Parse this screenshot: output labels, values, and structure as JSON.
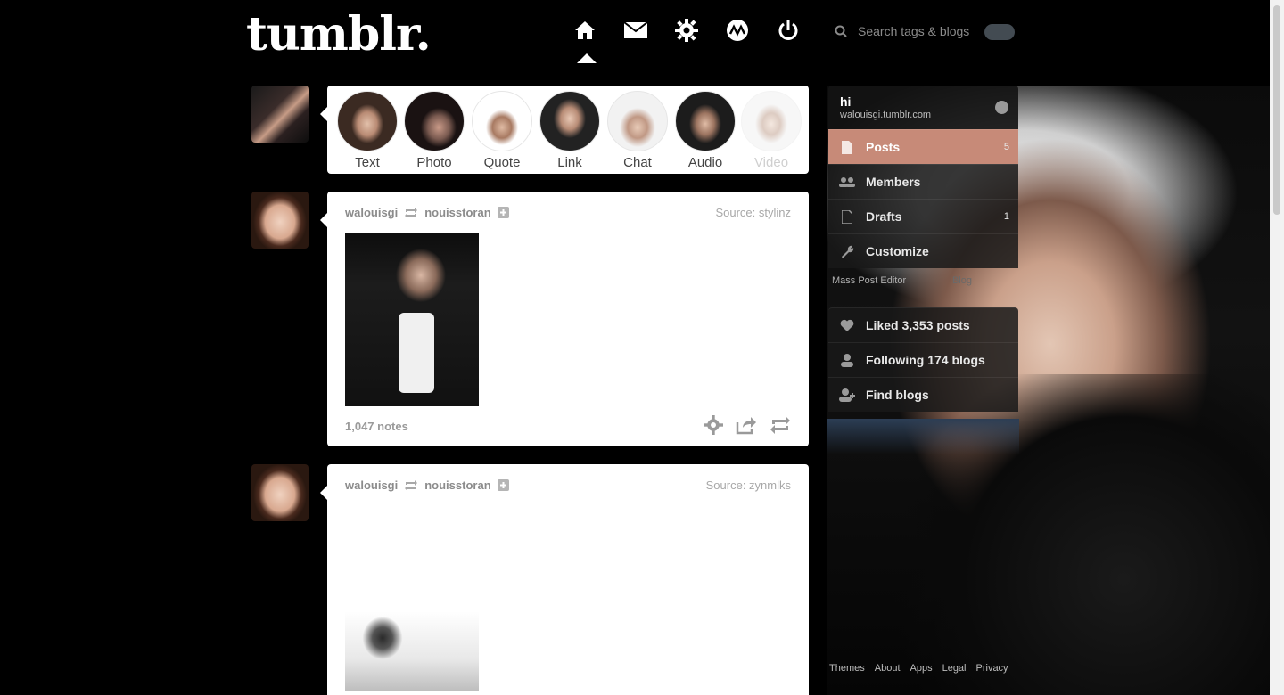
{
  "header": {
    "logo": "tumblr.",
    "search_placeholder": "Search tags & blogs",
    "nav": [
      "home-icon",
      "mail-icon",
      "gear-icon",
      "radar-icon",
      "power-icon"
    ]
  },
  "post_types": [
    {
      "label": "Text"
    },
    {
      "label": "Photo"
    },
    {
      "label": "Quote"
    },
    {
      "label": "Link"
    },
    {
      "label": "Chat"
    },
    {
      "label": "Audio"
    },
    {
      "label": "Video"
    }
  ],
  "posts": [
    {
      "user": "walouisgi",
      "reblogged_from": "nouisstoran",
      "source": "Source: stylinz",
      "notes": "1,047 notes"
    },
    {
      "user": "walouisgi",
      "reblogged_from": "nouisstoran",
      "source": "Source: zynmlks"
    }
  ],
  "sidebar": {
    "blog_name": "hi",
    "blog_url": "walouisgi.tumblr.com",
    "items": [
      {
        "label": "Posts",
        "count": "5",
        "active": true
      },
      {
        "label": "Members",
        "count": ""
      },
      {
        "label": "Drafts",
        "count": "1"
      },
      {
        "label": "Customize",
        "count": ""
      }
    ],
    "mass_post_editor": "Mass Post Editor",
    "blog_link": "Blog",
    "group2": [
      {
        "label": "Liked 3,353 posts"
      },
      {
        "label": "Following 174 blogs"
      },
      {
        "label": "Find blogs"
      }
    ]
  },
  "footer": [
    "Themes",
    "About",
    "Apps",
    "Legal",
    "Privacy"
  ],
  "colors": {
    "accent": "#c78a78",
    "background": "#000000"
  }
}
